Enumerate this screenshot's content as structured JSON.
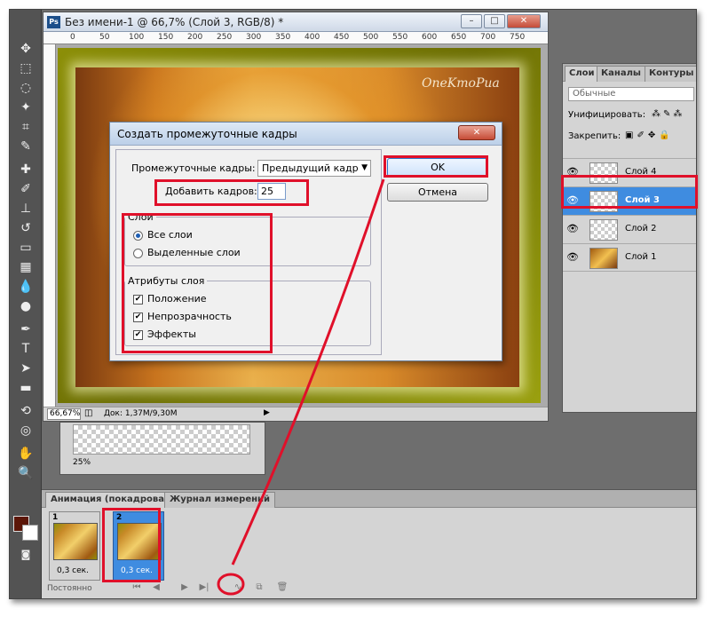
{
  "doc": {
    "app_icon": "Ps",
    "title": "Без имени-1 @ 66,7% (Слой 3, RGB/8) *",
    "ruler": [
      "0",
      "50",
      "100",
      "150",
      "200",
      "250",
      "300",
      "350",
      "400",
      "450",
      "500",
      "550",
      "600",
      "650",
      "700",
      "750"
    ],
    "watermark": "OneKmoPua",
    "zoom": "66,67%",
    "info": "Док: 1,37M/9,30M"
  },
  "navigator": {
    "zoom": "25%"
  },
  "layers_panel": {
    "tabs": [
      "Слои",
      "Каналы",
      "Контуры"
    ],
    "blend_mode": "Обычные",
    "unify_label": "Унифицировать:",
    "lock_label": "Закрепить:",
    "layers": [
      {
        "name": "Слой 4",
        "selected": false
      },
      {
        "name": "Слой 3",
        "selected": true
      },
      {
        "name": "Слой 2",
        "selected": false
      },
      {
        "name": "Слой 1",
        "selected": false
      }
    ]
  },
  "animation": {
    "tabs": [
      "Анимация (покадровая)",
      "Журнал измерений"
    ],
    "frames": [
      {
        "num": "1",
        "delay": "0,3 сек.",
        "selected": false
      },
      {
        "num": "2",
        "delay": "0,3 сек.",
        "selected": true
      }
    ],
    "loop": "Постоянно"
  },
  "dialog": {
    "title": "Создать промежуточные кадры",
    "tween_label": "Промежуточные кадры:",
    "tween_value": "Предыдущий кадр",
    "add_frames_label": "Добавить кадров:",
    "add_frames_value": "25",
    "layers_group": "Слои",
    "all_layers": "Все слои",
    "selected_layers": "Выделенные слои",
    "attributes_group": "Атрибуты слоя",
    "position": "Положение",
    "opacity": "Непрозрачность",
    "effects": "Эффекты",
    "ok": "OK",
    "cancel": "Отмена"
  },
  "colors": {
    "highlight": "#e0102a",
    "selection": "#3f8ce0"
  }
}
